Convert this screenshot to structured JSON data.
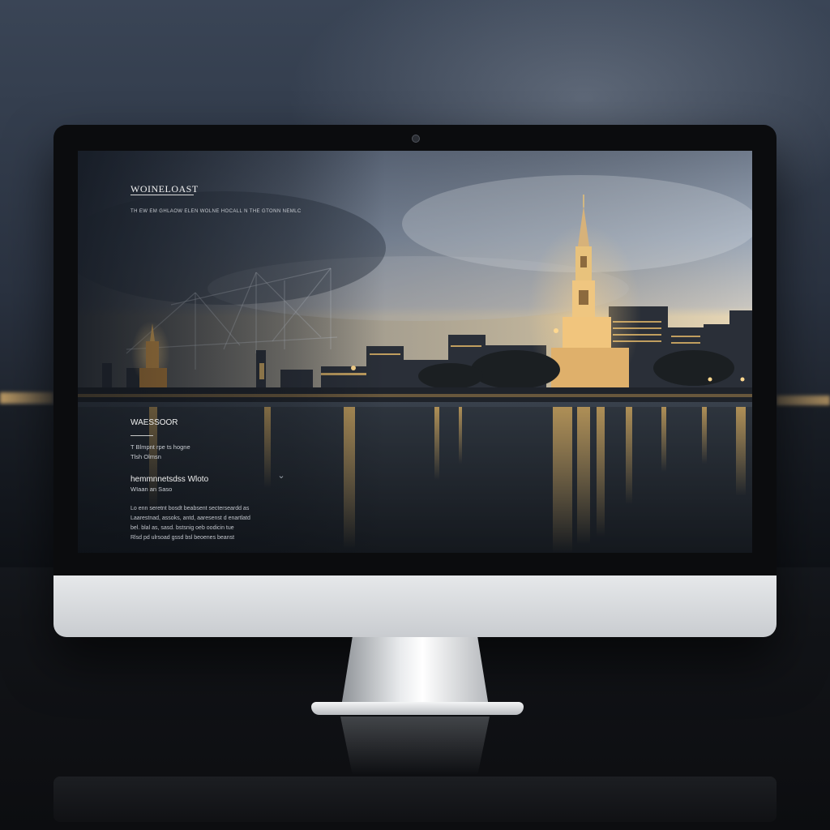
{
  "website": {
    "logo": "WOINELOAST",
    "tagline": "TH EW EM GHLAOW ELEN WOLNE HOCALL N THE GTONN NEMLC",
    "section": {
      "heading": "WAESSOOR",
      "lines": [
        "T Blmpnt rpe ts hogne",
        "Tlsh Olmsn"
      ]
    },
    "feature": {
      "heading": "hemmnnetsdss Wloto",
      "caption": "WIaan an Saso"
    },
    "paragraph": [
      "Lo enn seretnt bosdt beabsent secterseardd as",
      "Laarestnad, assoks, antd, aaresenst d enartlatd",
      "bel. blal as, sasd. bstsnig oeb oodicin tue",
      "Rlsd pd ulrsoad gssd bsl beoenes beanst"
    ],
    "scroll_icon": "chevron-down-icon"
  },
  "colors": {
    "bezel": "#0b0c0e",
    "chin": "#d8dadd",
    "city_light": "#f6c46a",
    "sky": "#9aa6b6"
  }
}
